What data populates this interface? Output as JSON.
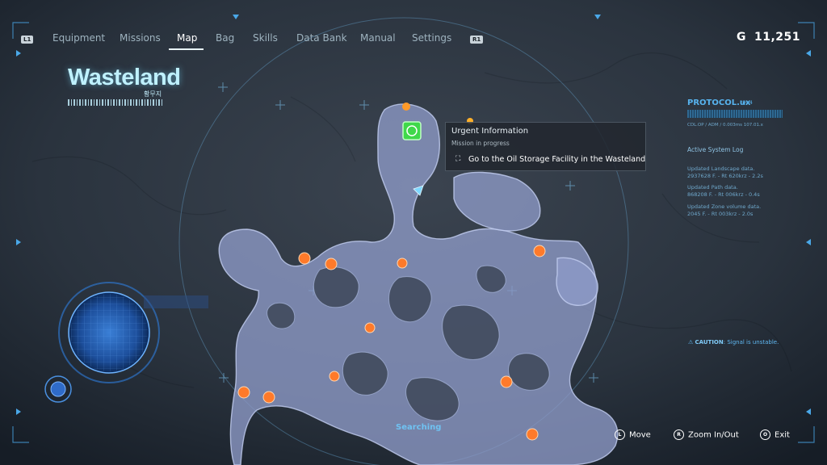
{
  "menu": {
    "left_hint": "L1",
    "right_hint": "R1",
    "tabs": [
      {
        "label": "Equipment"
      },
      {
        "label": "Missions"
      },
      {
        "label": "Map"
      },
      {
        "label": "Bag"
      },
      {
        "label": "Skills"
      },
      {
        "label": "Data Bank"
      },
      {
        "label": "Manual"
      },
      {
        "label": "Settings"
      }
    ],
    "active_tab": "Map"
  },
  "currency": {
    "symbol": "G",
    "amount": "11,251"
  },
  "region": {
    "name": "Wasteland",
    "subtitle": "황무지"
  },
  "tooltip": {
    "title": "Urgent Information",
    "status": "Mission in progress",
    "objective": "Go to the Oil Storage Facility in the Wasteland"
  },
  "system_panel": {
    "protocol": "PROTOCOL.ux",
    "revision": "rev.4",
    "stats": "CDL.OP / ADM / 0.003ms   107.01.x",
    "log_title": "Active System Log",
    "entries": [
      {
        "label": "Updated Landscape data.",
        "value": "2937628 F.  - Rt 620krz  - 2.2s"
      },
      {
        "label": "Updated Path data.",
        "value": "868208 F.  - Rt 006krz  - 0.4s"
      },
      {
        "label": "Updated Zone volume data.",
        "value": "2045 F.  - Rt 003krz  - 2.0s"
      }
    ],
    "caution_label": "CAUTION",
    "caution_text": ": Signal is unstable."
  },
  "scan_status": "Searching",
  "controls": [
    {
      "icon": "L",
      "label": "Move"
    },
    {
      "icon": "R",
      "label": "Zoom In/Out"
    },
    {
      "icon": "O",
      "label": "Exit"
    }
  ],
  "colors": {
    "land_fill": "#8e9bc8",
    "marker_orange": "#ff7a2a",
    "marker_active": "#3fd84a",
    "hud_blue": "#4aa8e8"
  }
}
